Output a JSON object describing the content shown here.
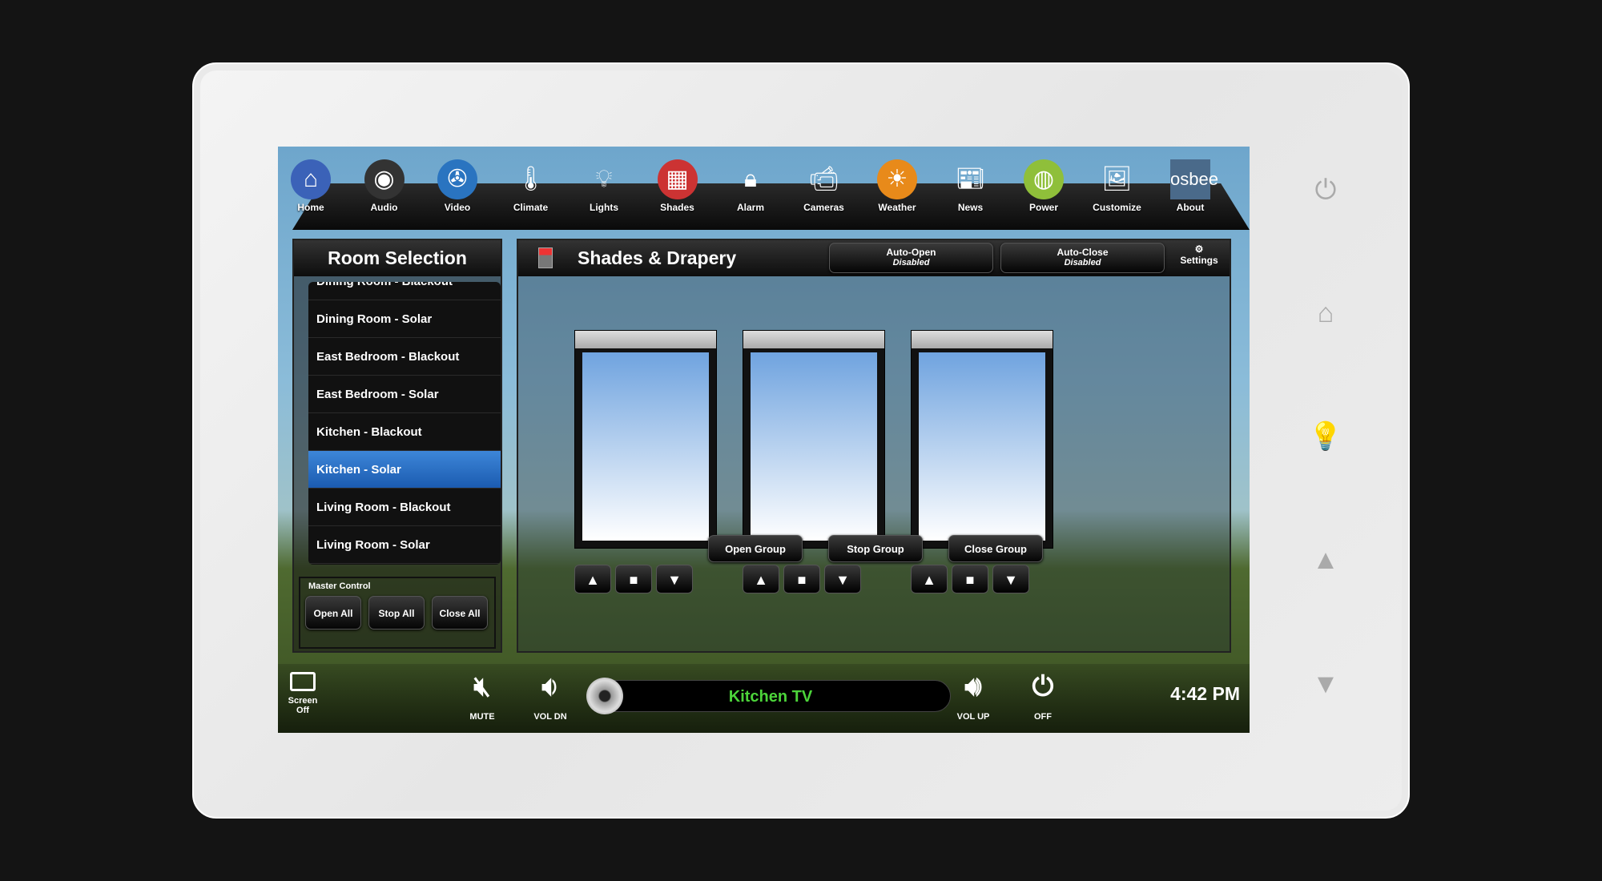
{
  "nav": [
    {
      "label": "Home",
      "icon": "home-icon"
    },
    {
      "label": "Audio",
      "icon": "speaker-icon"
    },
    {
      "label": "Video",
      "icon": "film-reel-icon"
    },
    {
      "label": "Climate",
      "icon": "thermometer-icon"
    },
    {
      "label": "Lights",
      "icon": "lightbulb-icon"
    },
    {
      "label": "Shades",
      "icon": "shades-icon"
    },
    {
      "label": "Alarm",
      "icon": "padlock-icon"
    },
    {
      "label": "Cameras",
      "icon": "camera-icon"
    },
    {
      "label": "Weather",
      "icon": "weather-icon"
    },
    {
      "label": "News",
      "icon": "newspaper-icon"
    },
    {
      "label": "Power",
      "icon": "globe-icon"
    },
    {
      "label": "Customize",
      "icon": "photos-icon"
    },
    {
      "label": "About",
      "icon": "osbee-logo",
      "logo_text": "osbee"
    }
  ],
  "room_selection": {
    "title": "Room Selection",
    "rooms": [
      "Dining Room - Blackout",
      "Dining Room - Solar",
      "East Bedroom - Blackout",
      "East Bedroom - Solar",
      "Kitchen - Blackout",
      "Kitchen - Solar",
      "Living Room - Blackout",
      "Living Room - Solar"
    ],
    "selected": "Kitchen - Solar",
    "master_label": "Master Control",
    "open_all": "Open All",
    "stop_all": "Stop All",
    "close_all": "Close All"
  },
  "main": {
    "title": "Shades & Drapery",
    "auto_open": "Auto-Open",
    "auto_open_state": "Disabled",
    "auto_close": "Auto-Close",
    "auto_close_state": "Disabled",
    "settings": "Settings",
    "open_group": "Open Group",
    "stop_group": "Stop Group",
    "close_group": "Close Group"
  },
  "bottom": {
    "screen_off": "Screen Off",
    "mute": "MUTE",
    "vol_dn": "VOL DN",
    "source": "Kitchen TV",
    "vol_up": "VOL UP",
    "off": "OFF",
    "time": "4:42 PM"
  },
  "colors": {
    "selected": "#2a6fc7",
    "source_text": "#4cd43a"
  }
}
